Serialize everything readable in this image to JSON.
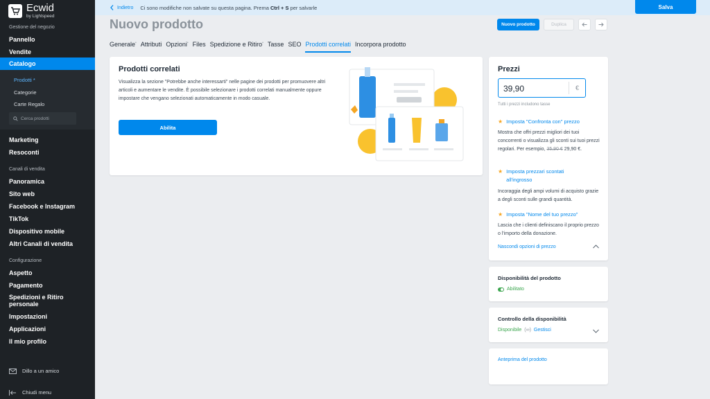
{
  "brand": {
    "name": "Ecwid",
    "sub": "by Lightspeed"
  },
  "sidebar": {
    "section_store": "Gestione del negozio",
    "items_top": [
      "Pannello",
      "Vendite"
    ],
    "active": "Catalogo",
    "submenu": [
      "Prodotti *",
      "Categorie",
      "Carte Regalo"
    ],
    "search_placeholder": "Cerca prodotti",
    "items_mid": [
      "Marketing",
      "Resoconti"
    ],
    "section_channels": "Canali di vendita",
    "channels": [
      "Panoramica",
      "Sito web",
      "Facebook e Instagram",
      "TikTok",
      "Dispositivo mobile",
      "Altri Canali di vendita"
    ],
    "section_config": "Configurazione",
    "config": [
      "Aspetto",
      "Pagamento",
      "Spedizioni e Ritiro personale",
      "Impostazioni",
      "Applicazioni",
      "Il mio profilo"
    ],
    "tell_friend": "Dillo a un amico",
    "collapse": "Chiudi menu"
  },
  "topbar": {
    "back": "Indietro",
    "message_pre": "Ci sono modifiche non salvate su questa pagina. Prema",
    "shortcut": "Ctrl + S",
    "message_post": "per salvarle",
    "save": "Salva"
  },
  "header": {
    "title": "Nuovo prodotto",
    "new_product": "Nuovo prodotto",
    "duplicate": "Duplica"
  },
  "tabs": [
    {
      "label": "Generale",
      "sup": "•"
    },
    {
      "label": "Attributi",
      "sup": ""
    },
    {
      "label": "Opzioni",
      "sup": "•"
    },
    {
      "label": "Files",
      "sup": ""
    },
    {
      "label": "Spedizione e Ritiro",
      "sup": "•"
    },
    {
      "label": "Tasse",
      "sup": ""
    },
    {
      "label": "SEO",
      "sup": ""
    },
    {
      "label": "Prodotti correlati",
      "sup": ""
    },
    {
      "label": "Incorpora prodotto",
      "sup": ""
    }
  ],
  "active_tab": "Prodotti correlati",
  "related": {
    "title": "Prodotti correlati",
    "description": "Visualizza la sezione \"Potrebbe anche interessarti\" nelle pagine dei prodotti per promuovere altri articoli e aumentare le vendite. È possibile selezionare i prodotti correlati manualmente oppure impostare che vengano selezionati automaticamente in modo casuale.",
    "enable": "Abilita"
  },
  "prices": {
    "title": "Prezzi",
    "value": "39,90",
    "currency": "€",
    "note": "Tutti i prezzi includono tasse",
    "compare_title": "Imposta \"Confronta con\" prezzo",
    "compare_desc_pre": "Mostra che offri prezzi migliori dei tuoi concorrenti o visualizza gli sconti sui tuoi prezzi regolari. Per esempio,",
    "compare_old": "35,90 €",
    "compare_new": "29,90 €.",
    "bulk_title": "Imposta prezzari scontati all'ingrosso",
    "bulk_desc": "Incoraggia degli ampi volumi di acquisto grazie a degli sconti sulle grandi quantità.",
    "pwyw_title": "Imposta \"Nome del tuo prezzo\"",
    "pwyw_desc": "Lascia che i clienti definiscano il proprio prezzo o l'importo della donazione.",
    "hide_options": "Nascondi opzioni di prezzo"
  },
  "availability": {
    "title": "Disponibilità del prodotto",
    "status": "Abilitato"
  },
  "stock": {
    "title": "Controllo della disponibilità",
    "status": "Disponibile",
    "infinity": "(∞)",
    "manage": "Gestisci"
  },
  "preview": {
    "link": "Anteprima del prodotto"
  },
  "colors": {
    "accent": "#0088ec",
    "sidebar": "#1e2226",
    "success": "#3ca64f",
    "star": "#f5a623"
  }
}
